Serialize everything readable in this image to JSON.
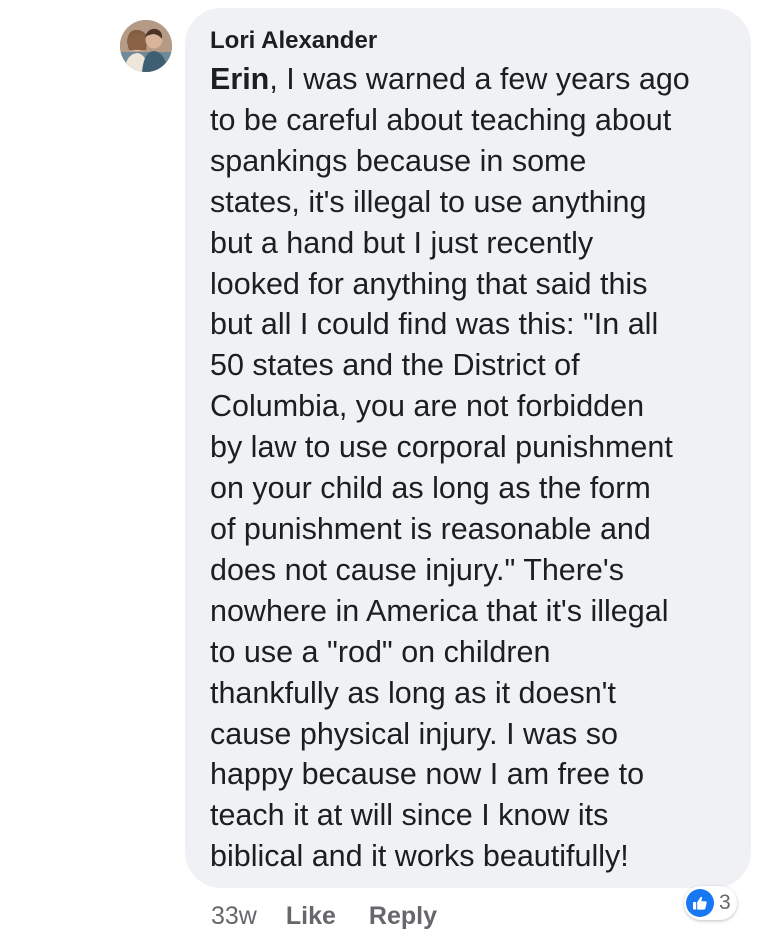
{
  "comment": {
    "author": "Lori Alexander",
    "mention": "Erin",
    "body": ", I was warned a few years ago\nto be careful about teaching about\nspankings because in some\nstates, it's illegal to use anything\nbut a hand but I just recently\nlooked for anything that said this\nbut all I could find was this: \"In all\n50 states and the District of\nColumbia, you are not forbidden\nby law to use corporal punishment\non your child as long as the form\nof punishment is reasonable and\ndoes not cause injury.\" There's\nnowhere in America that it's illegal\nto use a \"rod\" on children\nthankfully as long as it doesn't\ncause physical injury. I was so\nhappy because now I am free to\nteach it at will since I know its\nbiblical and it works beautifully!"
  },
  "actions": {
    "timestamp": "33w",
    "like_label": "Like",
    "reply_label": "Reply"
  },
  "reactions": {
    "icon": "thumbs-up-icon",
    "count": "3",
    "color": "#1877f2"
  },
  "colors": {
    "bubble": "#f0f1f4",
    "text": "#1c1e21",
    "secondary": "#65676b"
  }
}
